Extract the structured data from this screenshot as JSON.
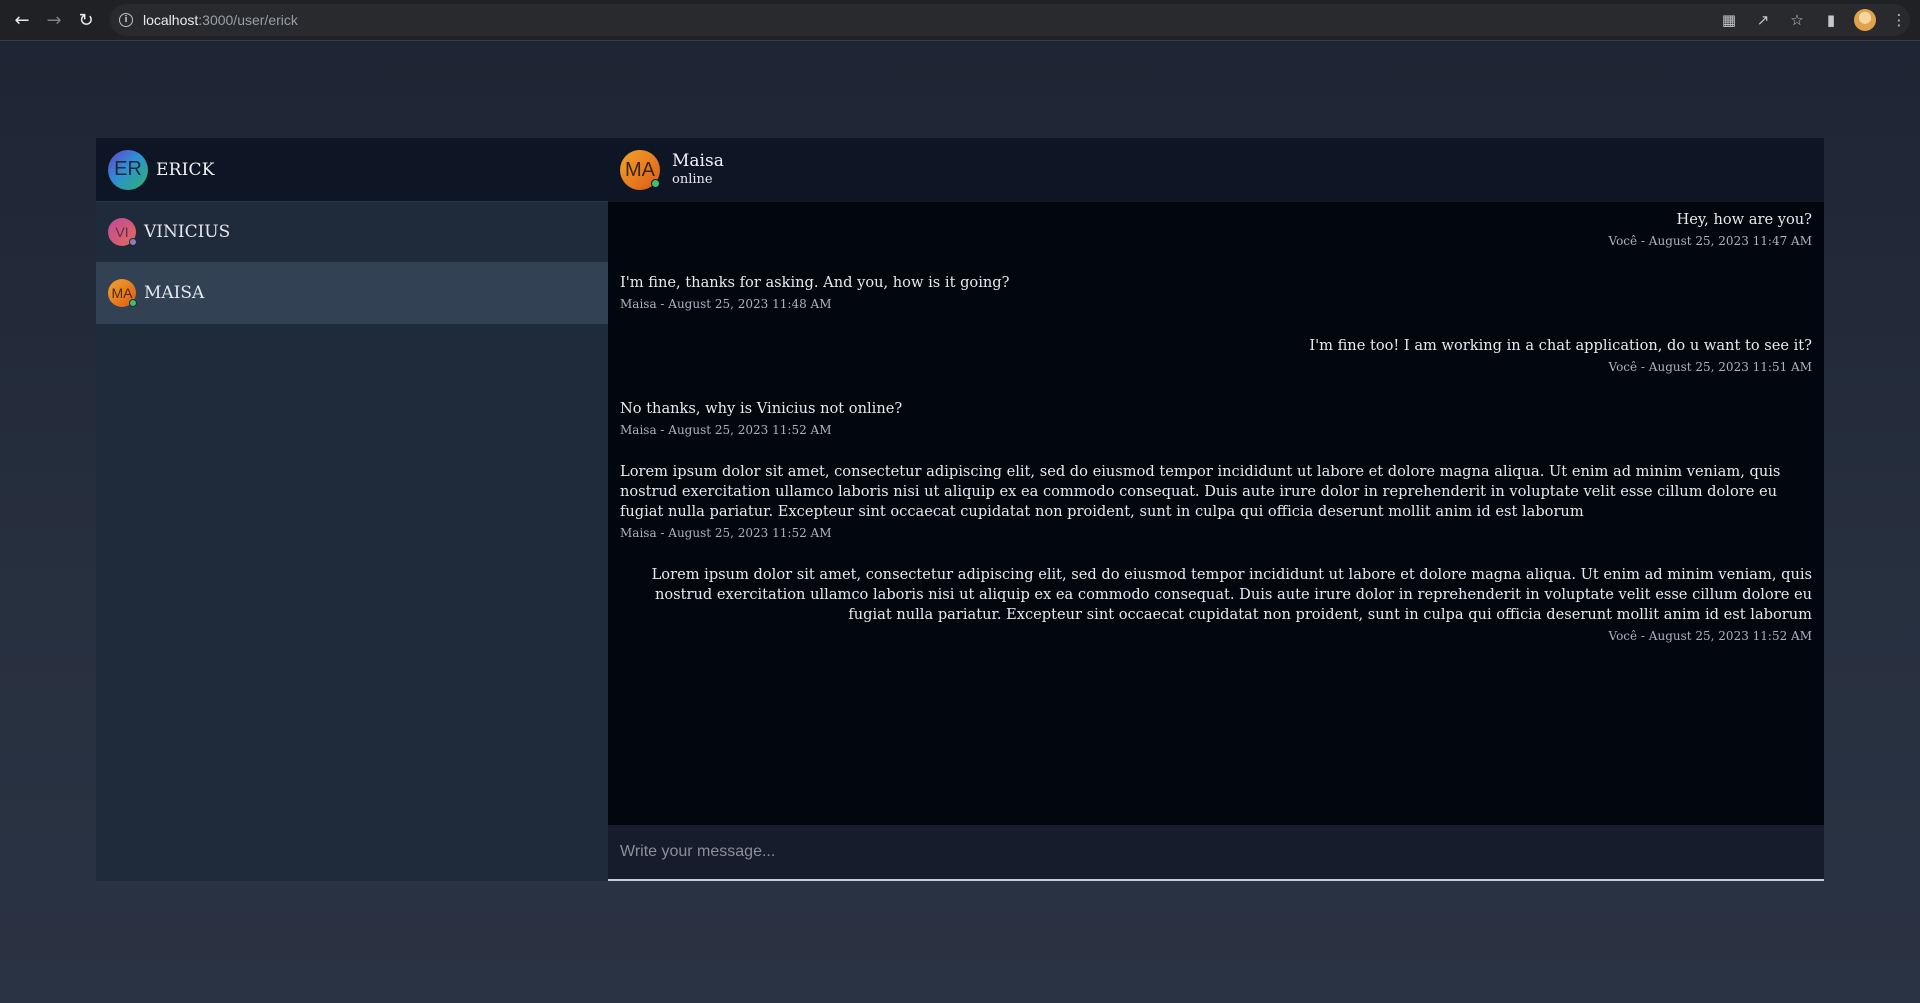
{
  "browser": {
    "url_host": "localhost",
    "url_path": ":3000/user/erick",
    "back_icon": "arrow-left-icon",
    "forward_icon": "arrow-right-icon",
    "reload_icon": "reload-icon"
  },
  "sidebar": {
    "me": {
      "initials": "ER",
      "name": "ERICK"
    },
    "contacts": [
      {
        "initials": "VI",
        "name": "VINICIUS",
        "status_color": "#8a7fb8"
      },
      {
        "initials": "MA",
        "name": "MAISA",
        "status_color": "#3cc26b"
      }
    ]
  },
  "chat": {
    "header": {
      "initials": "MA",
      "name": "Maisa",
      "status": "online",
      "status_color": "#3cc26b"
    },
    "messages": [
      {
        "direction": "sent",
        "text": "Hey, how are you?",
        "meta": "Você - August 25, 2023 11:47 AM"
      },
      {
        "direction": "received",
        "text": "I'm fine, thanks for asking. And you, how is it going?",
        "meta": "Maisa - August 25, 2023 11:48 AM"
      },
      {
        "direction": "sent",
        "text": "I'm fine too! I am working in a chat application, do u want to see it?",
        "meta": "Você - August 25, 2023 11:51 AM"
      },
      {
        "direction": "received",
        "text": "No thanks, why is Vinicius not online?",
        "meta": "Maisa - August 25, 2023 11:52 AM"
      },
      {
        "direction": "received",
        "text": "Lorem ipsum dolor sit amet, consectetur adipiscing elit, sed do eiusmod tempor incididunt ut labore et dolore magna aliqua. Ut enim ad minim veniam, quis nostrud exercitation ullamco laboris nisi ut aliquip ex ea commodo consequat. Duis aute irure dolor in reprehenderit in voluptate velit esse cillum dolore eu fugiat nulla pariatur. Excepteur sint occaecat cupidatat non proident, sunt in culpa qui officia deserunt mollit anim id est laborum",
        "meta": "Maisa - August 25, 2023 11:52 AM"
      },
      {
        "direction": "sent",
        "text": "Lorem ipsum dolor sit amet, consectetur adipiscing elit, sed do eiusmod tempor incididunt ut labore et dolore magna aliqua. Ut enim ad minim veniam, quis nostrud exercitation ullamco laboris nisi ut aliquip ex ea commodo consequat. Duis aute irure dolor in reprehenderit in voluptate velit esse cillum dolore eu fugiat nulla pariatur. Excepteur sint occaecat cupidatat non proident, sunt in culpa qui officia deserunt mollit anim id est laborum",
        "meta": "Você - August 25, 2023 11:52 AM"
      }
    ],
    "composer": {
      "placeholder": "Write your message..."
    }
  }
}
